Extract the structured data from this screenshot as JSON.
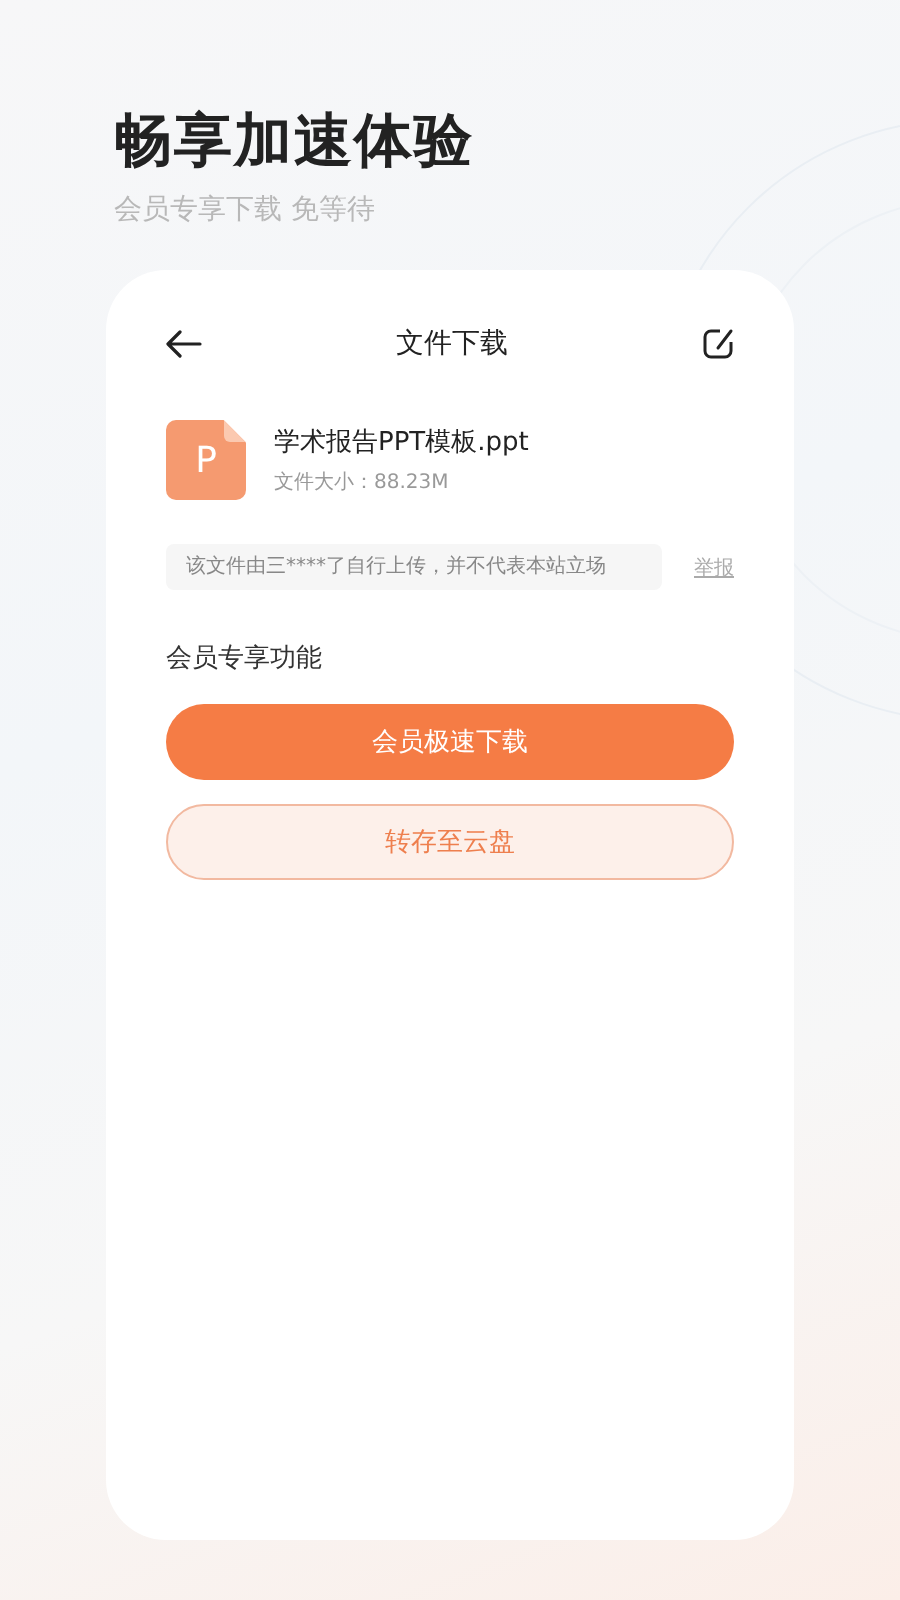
{
  "header": {
    "title": "畅享加速体验",
    "subtitle": "会员专享下载 免等待"
  },
  "nav": {
    "title": "文件下载"
  },
  "file": {
    "icon_letter": "P",
    "name": "学术报告PPT模板.ppt",
    "size": "文件大小：88.23M"
  },
  "notice": {
    "text": "该文件由三****了自行上传，并不代表本站立场",
    "report": "举报"
  },
  "section": {
    "title": "会员专享功能"
  },
  "buttons": [
    {
      "label": "会员极速下载",
      "kind": "primary"
    },
    {
      "label": "转存至云盘",
      "kind": "secondary"
    }
  ]
}
